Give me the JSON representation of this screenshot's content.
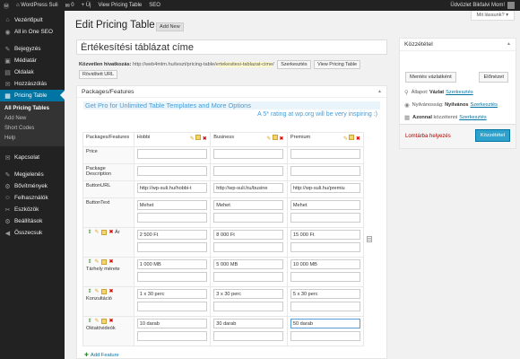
{
  "admin_bar": {
    "site_name": "WordPress Suli",
    "comments_count": "0",
    "new_label": "+ Új",
    "view_label": "View Pricing Table",
    "seo_label": "SEO",
    "greeting": "Üdvözlet Bikfalvi Mom!"
  },
  "sidebar": {
    "items_top": [
      {
        "label": "Vezérlőpult",
        "icon": "dashboard-icon",
        "glyph": "⌂"
      },
      {
        "label": "All in One SEO",
        "icon": "seo-icon",
        "glyph": "◉"
      }
    ],
    "items_mid": [
      {
        "label": "Bejegyzés",
        "icon": "pin-icon",
        "glyph": "✎"
      },
      {
        "label": "Médiatár",
        "icon": "media-icon",
        "glyph": "▣"
      },
      {
        "label": "Oldalak",
        "icon": "pages-icon",
        "glyph": "▤"
      },
      {
        "label": "Hozzászólás",
        "icon": "comments-icon",
        "glyph": "✉"
      }
    ],
    "active_item": {
      "label": "Pricing Table",
      "icon": "pricing-icon",
      "glyph": "▦"
    },
    "submenu": [
      "All Pricing Tables",
      "Add New",
      "Short Codes",
      "Help"
    ],
    "items_bottom1": [
      {
        "label": "Kapcsolat",
        "icon": "contact-icon",
        "glyph": "✉"
      }
    ],
    "items_bottom2": [
      {
        "label": "Megjelenés",
        "icon": "appearance-icon",
        "glyph": "✎"
      },
      {
        "label": "Bővítmények",
        "icon": "plugins-icon",
        "glyph": "⚙"
      },
      {
        "label": "Felhasználók",
        "icon": "users-icon",
        "glyph": "☺"
      },
      {
        "label": "Eszközök",
        "icon": "tools-icon",
        "glyph": "✂"
      },
      {
        "label": "Beállítások",
        "icon": "settings-icon",
        "glyph": "⚙"
      },
      {
        "label": "Összecsuk",
        "icon": "collapse-icon",
        "glyph": "◀"
      }
    ]
  },
  "header": {
    "title": "Edit Pricing Table",
    "add_new": "Add New",
    "screen_options": "Mit lássunk? ▾"
  },
  "post": {
    "title_value": "Értékesítési táblázat címe",
    "permalink_label": "Közvetlen hivatkozás:",
    "permalink_base": "http://web4mlm.hu/teszt/pricing-table/",
    "permalink_slug": "ertekesitesi-tablazat-cime",
    "permalink_end": "/",
    "btn_edit": "Szerkesztés",
    "btn_view": "View Pricing Table",
    "btn_shortlink": "Rövidített URL"
  },
  "packages": {
    "box_title": "Packages/Features",
    "promo": "Get Pro for Unlimited Table Templates and More Options",
    "rating": "A 5* rating at wp.org will be very inspiring :)",
    "corner": "Packages/Features",
    "columns": [
      "Hobbi",
      "Business",
      "Premium"
    ],
    "add_feature": "Add Feature"
  },
  "rows": {
    "price": {
      "label": "Price",
      "values": [
        "",
        "",
        ""
      ]
    },
    "pkg_desc": {
      "label": "Package Description",
      "values": [
        "",
        "",
        ""
      ]
    },
    "button_url": {
      "label": "ButtonURL",
      "values": [
        "http://wp-suli.hu/hobbi-t",
        "http://wp-suli.hu/busine",
        "http://wp-suli.hu/premiu"
      ]
    },
    "button_text": {
      "label": "ButtonText",
      "values": [
        "Mehet",
        "Mehet",
        "Mehet"
      ]
    },
    "feature_ar": {
      "label": "Ár",
      "values": [
        "2 500 Ft",
        "8 000 Ft",
        "15 000 Ft"
      ]
    },
    "feature_storage": {
      "label": "Tárhely mérete",
      "values": [
        "1 000 MB",
        "5 000 MB",
        "10 000 MB"
      ]
    },
    "feature_consult": {
      "label": "Konzultáció",
      "values": [
        "1 x 30 perc",
        "3 x 30 perc",
        "5 x 30 perc"
      ]
    },
    "feature_videos": {
      "label": "Oktatóvideók",
      "values": [
        "10 darab",
        "30 darab",
        "50 darab"
      ]
    }
  },
  "publish": {
    "title": "Közzététel",
    "save_draft": "Mentés vázlatként",
    "preview": "Előnézet",
    "status_label": "Állapot:",
    "status_value": "Vázlat",
    "visibility_label": "Nyilvánosság:",
    "visibility_value": "Nyilvános",
    "schedule_label": "Azonnal",
    "schedule_rest": "közzétenni",
    "edit_link": "Szerkesztés",
    "trash": "Lomtárba helyezés",
    "publish_btn": "Közzététel"
  }
}
